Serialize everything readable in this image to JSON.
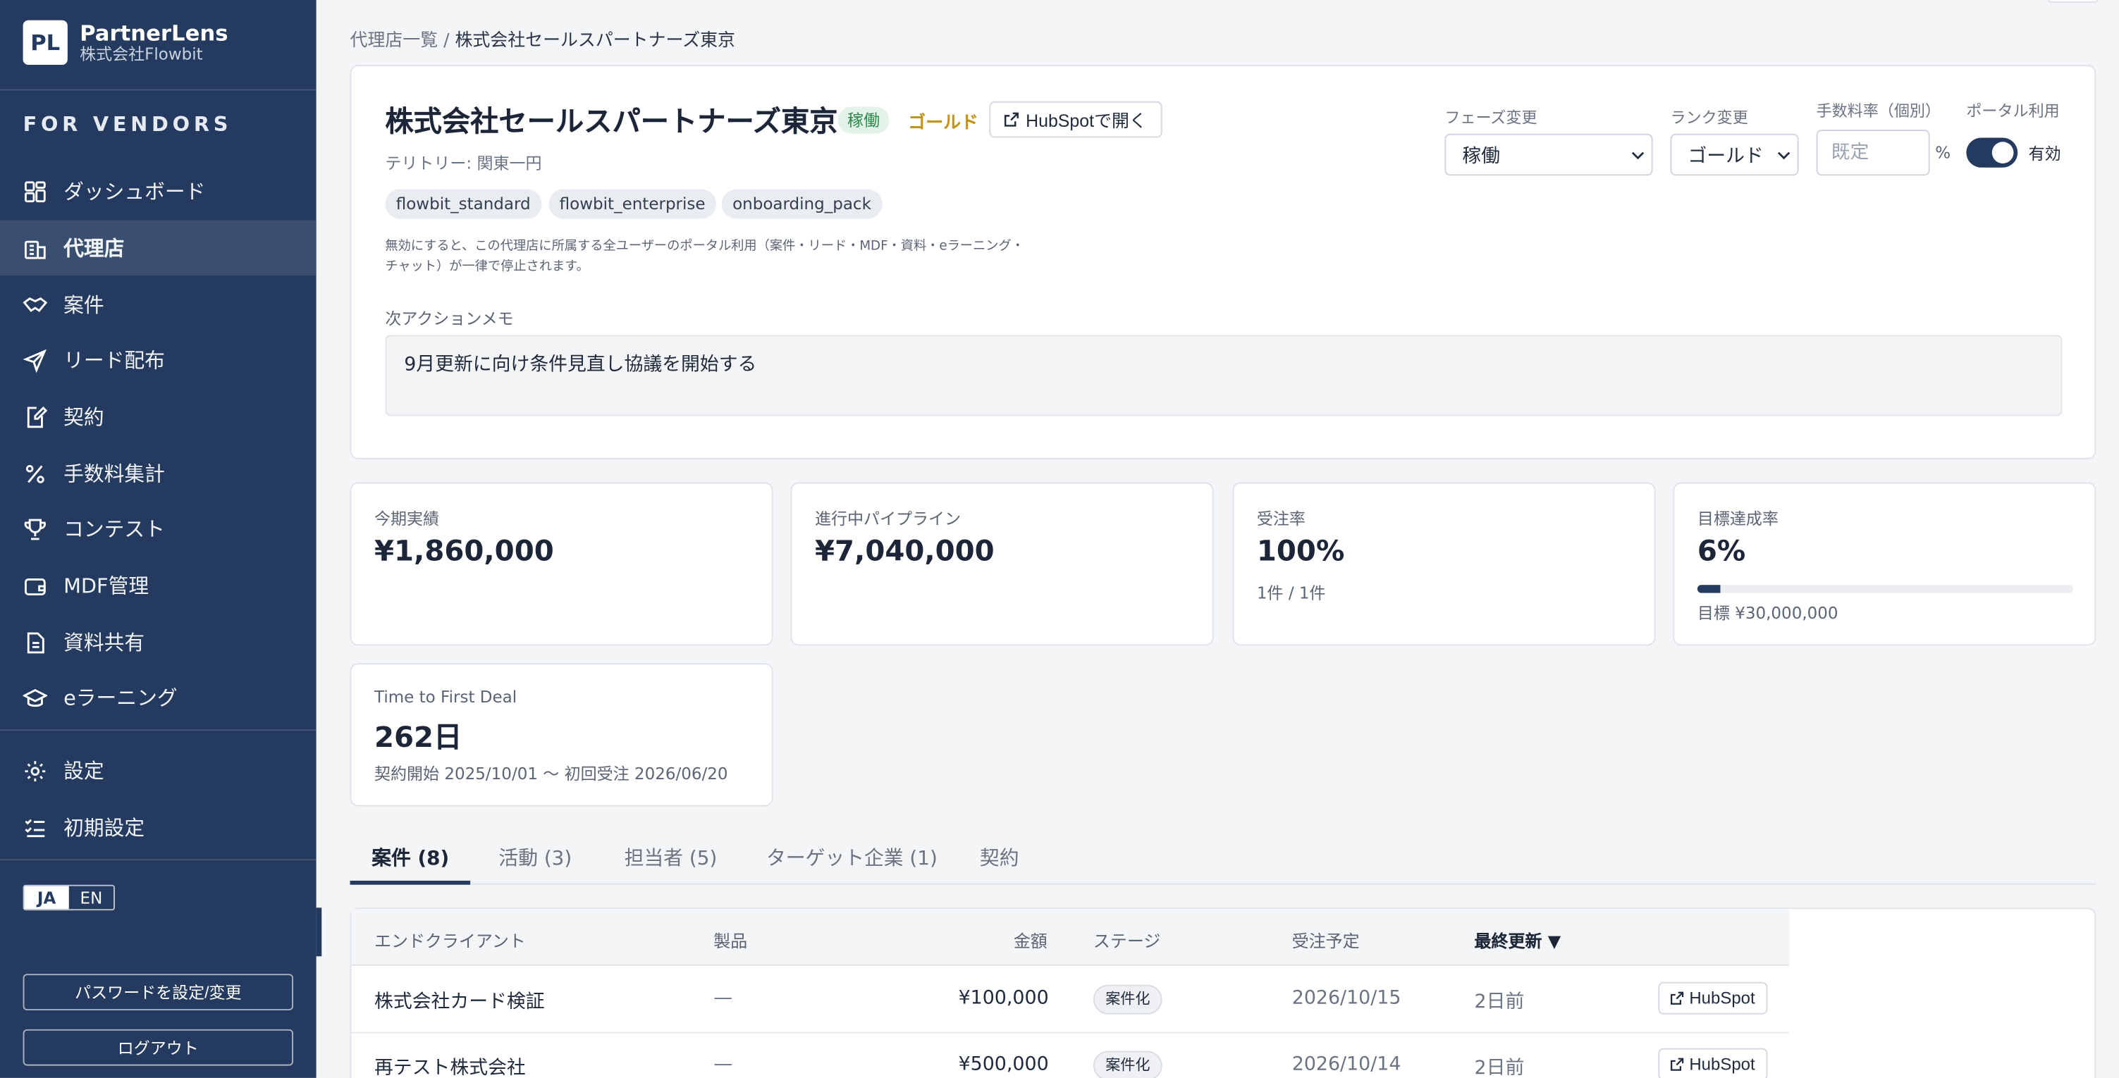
{
  "brand": {
    "logo": "PL",
    "name": "PartnerLens",
    "company": "株式会社Flowbit"
  },
  "sidebar": {
    "section_label": "FOR VENDORS",
    "items": [
      {
        "label": "ダッシュボード",
        "icon": "dashboard-icon"
      },
      {
        "label": "代理店",
        "icon": "building-icon",
        "active": true
      },
      {
        "label": "案件",
        "icon": "handshake-icon"
      },
      {
        "label": "リード配布",
        "icon": "send-icon"
      },
      {
        "label": "契約",
        "icon": "contract-edit-icon"
      },
      {
        "label": "手数料集計",
        "icon": "percent-icon"
      },
      {
        "label": "コンテスト",
        "icon": "trophy-icon"
      },
      {
        "label": "MDF管理",
        "icon": "wallet-icon"
      },
      {
        "label": "資料共有",
        "icon": "document-icon"
      },
      {
        "label": "eラーニング",
        "icon": "graduation-cap-icon"
      }
    ],
    "settings_items": [
      {
        "label": "設定",
        "icon": "gear-icon"
      },
      {
        "label": "初期設定",
        "icon": "checklist-icon"
      }
    ],
    "lang": {
      "ja": "JA",
      "en": "EN",
      "selected": "JA"
    },
    "password_button": "パスワードを設定/変更",
    "logout_button": "ログアウト"
  },
  "breadcrumb": {
    "parent": "代理店一覧",
    "separator": "/",
    "current": "株式会社セールスパートナーズ東京"
  },
  "partner": {
    "name": "株式会社セールスパートナーズ東京",
    "status_badge": "稼働",
    "rank_badge": "ゴールド",
    "hubspot_open": "HubSpotで開く",
    "territory": "テリトリー: 関東一円",
    "tags": [
      "flowbit_standard",
      "flowbit_enterprise",
      "onboarding_pack"
    ],
    "note_line1": "無効にすると、この代理店に所属する全ユーザーのポータル利用（案件・リード・MDF・資料・eラーニング・",
    "note_line2": "チャット）が一律で停止されます。",
    "memo_label": "次アクションメモ",
    "memo": "9月更新に向け条件見直し協議を開始する"
  },
  "controls": {
    "phase_label": "フェーズ変更",
    "phase_value": "稼働",
    "rank_label": "ランク変更",
    "rank_value": "ゴールド",
    "fee_label": "手数料率（個別）",
    "fee_placeholder": "既定",
    "fee_unit": "%",
    "portal_label": "ポータル利用",
    "portal_value": "有効",
    "portal_enabled": true
  },
  "kpis": {
    "revenue": {
      "label": "今期実績",
      "value": "¥1,860,000"
    },
    "pipeline": {
      "label": "進行中パイプライン",
      "value": "¥7,040,000"
    },
    "win_rate": {
      "label": "受注率",
      "value": "100%",
      "sub": "1件 / 1件"
    },
    "target": {
      "label": "目標達成率",
      "value": "6%",
      "progress": 0.06,
      "sub": "目標 ¥30,000,000"
    },
    "ttfd": {
      "label": "Time to First Deal",
      "value": "262日",
      "sub": "契約開始 2025/10/01 〜 初回受注 2026/06/20"
    }
  },
  "tabs": [
    {
      "label": "案件 (8)",
      "active": true
    },
    {
      "label": "活動 (3)"
    },
    {
      "label": "担当者 (5)"
    },
    {
      "label": "ターゲット企業 (1)"
    },
    {
      "label": "契約"
    }
  ],
  "table": {
    "headers": {
      "client": "エンドクライアント",
      "product": "製品",
      "amount": "金額",
      "stage": "ステージ",
      "expected": "受注予定",
      "updated": "最終更新 ▼"
    },
    "rows": [
      {
        "client": "株式会社カード検証",
        "product": "—",
        "amount": "¥100,000",
        "stage": "案件化",
        "expected": "2026/10/15",
        "updated": "2日前",
        "action": "HubSpot"
      },
      {
        "client": "再テスト株式会社",
        "product": "—",
        "amount": "¥500,000",
        "stage": "案件化",
        "expected": "2026/10/14",
        "updated": "2日前",
        "action": "HubSpot"
      }
    ]
  },
  "colors": {
    "sidebar": "#243a5e",
    "accent": "#243a5e",
    "status_green": "#2d8a4c",
    "rank_gold": "#c49319"
  }
}
